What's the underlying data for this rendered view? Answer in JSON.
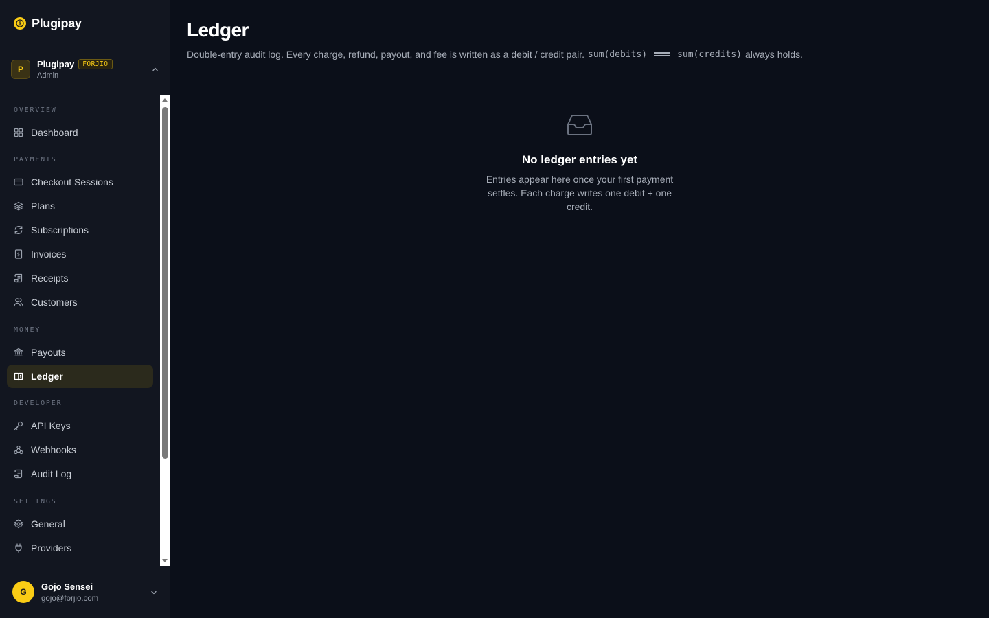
{
  "brand": {
    "name": "Plugipay"
  },
  "org": {
    "avatar": "P",
    "name": "Plugipay",
    "badge": "FORJIO",
    "role": "Admin"
  },
  "nav": {
    "sections": {
      "overview": "OVERVIEW",
      "payments": "PAYMENTS",
      "money": "MONEY",
      "developer": "DEVELOPER",
      "settings": "SETTINGS"
    },
    "items": {
      "dashboard": "Dashboard",
      "checkout_sessions": "Checkout Sessions",
      "plans": "Plans",
      "subscriptions": "Subscriptions",
      "invoices": "Invoices",
      "receipts": "Receipts",
      "customers": "Customers",
      "payouts": "Payouts",
      "ledger": "Ledger",
      "api_keys": "API Keys",
      "webhooks": "Webhooks",
      "audit_log": "Audit Log",
      "general": "General",
      "providers": "Providers"
    },
    "active": "ledger"
  },
  "user": {
    "avatar": "G",
    "name": "Gojo Sensei",
    "email": "gojo@forjio.com"
  },
  "page": {
    "title": "Ledger",
    "description_prefix": "Double-entry audit log. Every charge, refund, payout, and fee is written as a debit / credit pair.",
    "code_left": "sum(debits)",
    "code_right": "sum(credits)",
    "description_suffix": "always holds."
  },
  "empty_state": {
    "icon": "inbox-icon",
    "title": "No ledger entries yet",
    "text": "Entries appear here once your first payment settles. Each charge writes one debit + one credit."
  },
  "colors": {
    "accent": "#facc15",
    "background": "#0b0f19",
    "sidebar": "#121620",
    "active_item": "#2b2a1c"
  }
}
